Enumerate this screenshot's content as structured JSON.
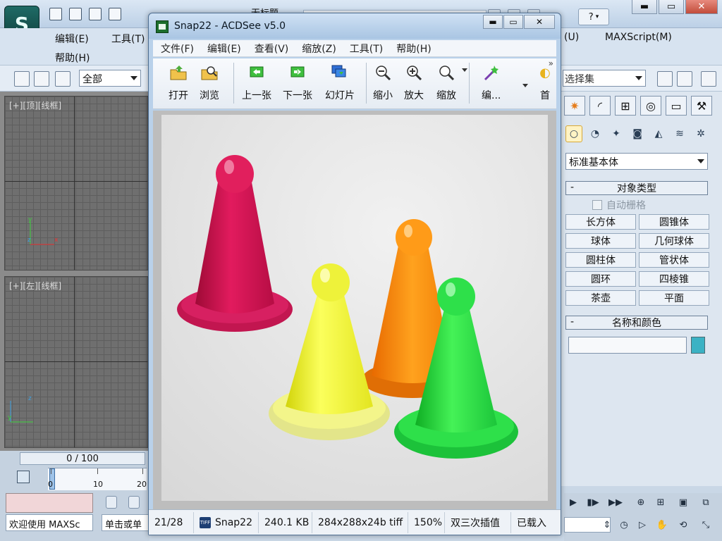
{
  "max": {
    "title_fragment": "无标题",
    "menu": [
      "编辑(E)",
      "工具(T)",
      "帮助(H)",
      "(U)",
      "MAXScript(M)"
    ],
    "help_label": "?",
    "selection_filter": "全部",
    "named_selection": "选择集",
    "viewport_top_label": "[+][顶][线框]",
    "viewport_left_label": "[+][左][线框]",
    "time_display": "0 / 100",
    "time_ticks": [
      "0",
      "10",
      "20"
    ],
    "welcome_text": "欢迎使用 MAXSc",
    "prompt_text": "单击或单",
    "command_panel": {
      "category": "标准基本体",
      "object_type_title": "对象类型",
      "autogrid": "自动栅格",
      "buttons": [
        "长方体",
        "圆锥体",
        "球体",
        "几何球体",
        "圆柱体",
        "管状体",
        "圆环",
        "四棱锥",
        "茶壶",
        "平面"
      ],
      "name_color_title": "名称和颜色",
      "swatch_color": "#3bb2c4"
    }
  },
  "acdsee": {
    "title": "Snap22 - ACDSee v5.0",
    "menu": [
      "文件(F)",
      "编辑(E)",
      "查看(V)",
      "缩放(Z)",
      "工具(T)",
      "帮助(H)"
    ],
    "tools": [
      "打开",
      "浏览",
      "上一张",
      "下一张",
      "幻灯片",
      "缩小",
      "放大",
      "缩放",
      "编..."
    ],
    "tool_overflow": "首",
    "more": "»",
    "status": {
      "position": "21/28",
      "filename": "Snap22",
      "filesize": "240.1 KB",
      "dimensions": "284x288x24b tiff",
      "zoom": "150%",
      "interpolation": "双三次插值",
      "loaded": "已载入"
    }
  }
}
